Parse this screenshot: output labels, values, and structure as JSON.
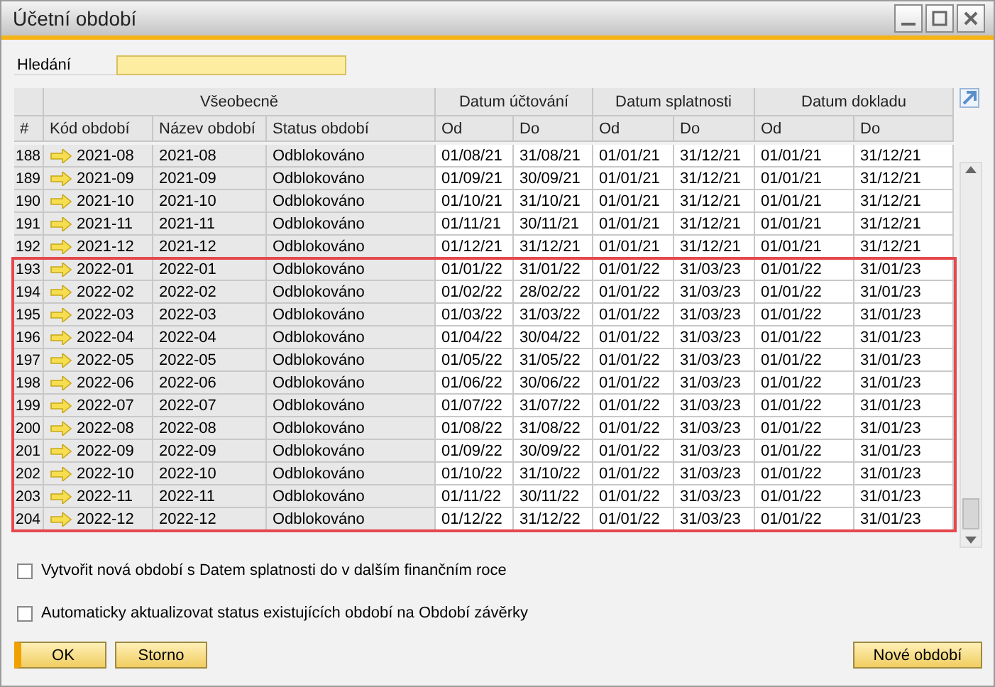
{
  "window": {
    "title": "Účetní období"
  },
  "search": {
    "label": "Hledání"
  },
  "table": {
    "groups": [
      {
        "label": "Všeobecně"
      },
      {
        "label": "Datum účtování"
      },
      {
        "label": "Datum splatnosti"
      },
      {
        "label": "Datum dokladu"
      }
    ],
    "columns": [
      "#",
      "Kód období",
      "Název období",
      "Status období",
      "Od",
      "Do",
      "Od",
      "Do",
      "Od",
      "Do"
    ],
    "rows": [
      {
        "cells": [
          "188",
          "2021-08",
          "2021-08",
          "Odblokováno",
          "01/08/21",
          "31/08/21",
          "01/01/21",
          "31/12/21",
          "01/01/21",
          "31/12/21"
        ],
        "marked": false
      },
      {
        "cells": [
          "189",
          "2021-09",
          "2021-09",
          "Odblokováno",
          "01/09/21",
          "30/09/21",
          "01/01/21",
          "31/12/21",
          "01/01/21",
          "31/12/21"
        ],
        "marked": false
      },
      {
        "cells": [
          "190",
          "2021-10",
          "2021-10",
          "Odblokováno",
          "01/10/21",
          "31/10/21",
          "01/01/21",
          "31/12/21",
          "01/01/21",
          "31/12/21"
        ],
        "marked": false
      },
      {
        "cells": [
          "191",
          "2021-11",
          "2021-11",
          "Odblokováno",
          "01/11/21",
          "30/11/21",
          "01/01/21",
          "31/12/21",
          "01/01/21",
          "31/12/21"
        ],
        "marked": false
      },
      {
        "cells": [
          "192",
          "2021-12",
          "2021-12",
          "Odblokováno",
          "01/12/21",
          "31/12/21",
          "01/01/21",
          "31/12/21",
          "01/01/21",
          "31/12/21"
        ],
        "marked": false
      },
      {
        "cells": [
          "193",
          "2022-01",
          "2022-01",
          "Odblokováno",
          "01/01/22",
          "31/01/22",
          "01/01/22",
          "31/03/23",
          "01/01/22",
          "31/01/23"
        ],
        "marked": true
      },
      {
        "cells": [
          "194",
          "2022-02",
          "2022-02",
          "Odblokováno",
          "01/02/22",
          "28/02/22",
          "01/01/22",
          "31/03/23",
          "01/01/22",
          "31/01/23"
        ],
        "marked": true
      },
      {
        "cells": [
          "195",
          "2022-03",
          "2022-03",
          "Odblokováno",
          "01/03/22",
          "31/03/22",
          "01/01/22",
          "31/03/23",
          "01/01/22",
          "31/01/23"
        ],
        "marked": true
      },
      {
        "cells": [
          "196",
          "2022-04",
          "2022-04",
          "Odblokováno",
          "01/04/22",
          "30/04/22",
          "01/01/22",
          "31/03/23",
          "01/01/22",
          "31/01/23"
        ],
        "marked": true
      },
      {
        "cells": [
          "197",
          "2022-05",
          "2022-05",
          "Odblokováno",
          "01/05/22",
          "31/05/22",
          "01/01/22",
          "31/03/23",
          "01/01/22",
          "31/01/23"
        ],
        "marked": true
      },
      {
        "cells": [
          "198",
          "2022-06",
          "2022-06",
          "Odblokováno",
          "01/06/22",
          "30/06/22",
          "01/01/22",
          "31/03/23",
          "01/01/22",
          "31/01/23"
        ],
        "marked": true
      },
      {
        "cells": [
          "199",
          "2022-07",
          "2022-07",
          "Odblokováno",
          "01/07/22",
          "31/07/22",
          "01/01/22",
          "31/03/23",
          "01/01/22",
          "31/01/23"
        ],
        "marked": true
      },
      {
        "cells": [
          "200",
          "2022-08",
          "2022-08",
          "Odblokováno",
          "01/08/22",
          "31/08/22",
          "01/01/22",
          "31/03/23",
          "01/01/22",
          "31/01/23"
        ],
        "marked": true
      },
      {
        "cells": [
          "201",
          "2022-09",
          "2022-09",
          "Odblokováno",
          "01/09/22",
          "30/09/22",
          "01/01/22",
          "31/03/23",
          "01/01/22",
          "31/01/23"
        ],
        "marked": true
      },
      {
        "cells": [
          "202",
          "2022-10",
          "2022-10",
          "Odblokováno",
          "01/10/22",
          "31/10/22",
          "01/01/22",
          "31/03/23",
          "01/01/22",
          "31/01/23"
        ],
        "marked": true
      },
      {
        "cells": [
          "203",
          "2022-11",
          "2022-11",
          "Odblokováno",
          "01/11/22",
          "30/11/22",
          "01/01/22",
          "31/03/23",
          "01/01/22",
          "31/01/23"
        ],
        "marked": true
      },
      {
        "cells": [
          "204",
          "2022-12",
          "2022-12",
          "Odblokováno",
          "01/12/22",
          "31/12/22",
          "01/01/22",
          "31/03/23",
          "01/01/22",
          "31/01/23"
        ],
        "marked": true
      }
    ]
  },
  "options": [
    {
      "label": "Vytvořit nová období s Datem splatnosti do v dalším finančním roce",
      "checked": false
    },
    {
      "label": "Automaticky aktualizovat status existujících období na Období závěrky",
      "checked": false
    }
  ],
  "buttons": [
    {
      "label": "OK",
      "default": true
    },
    {
      "label": "Storno",
      "default": false
    }
  ],
  "new_button": {
    "label": "Nové období"
  }
}
